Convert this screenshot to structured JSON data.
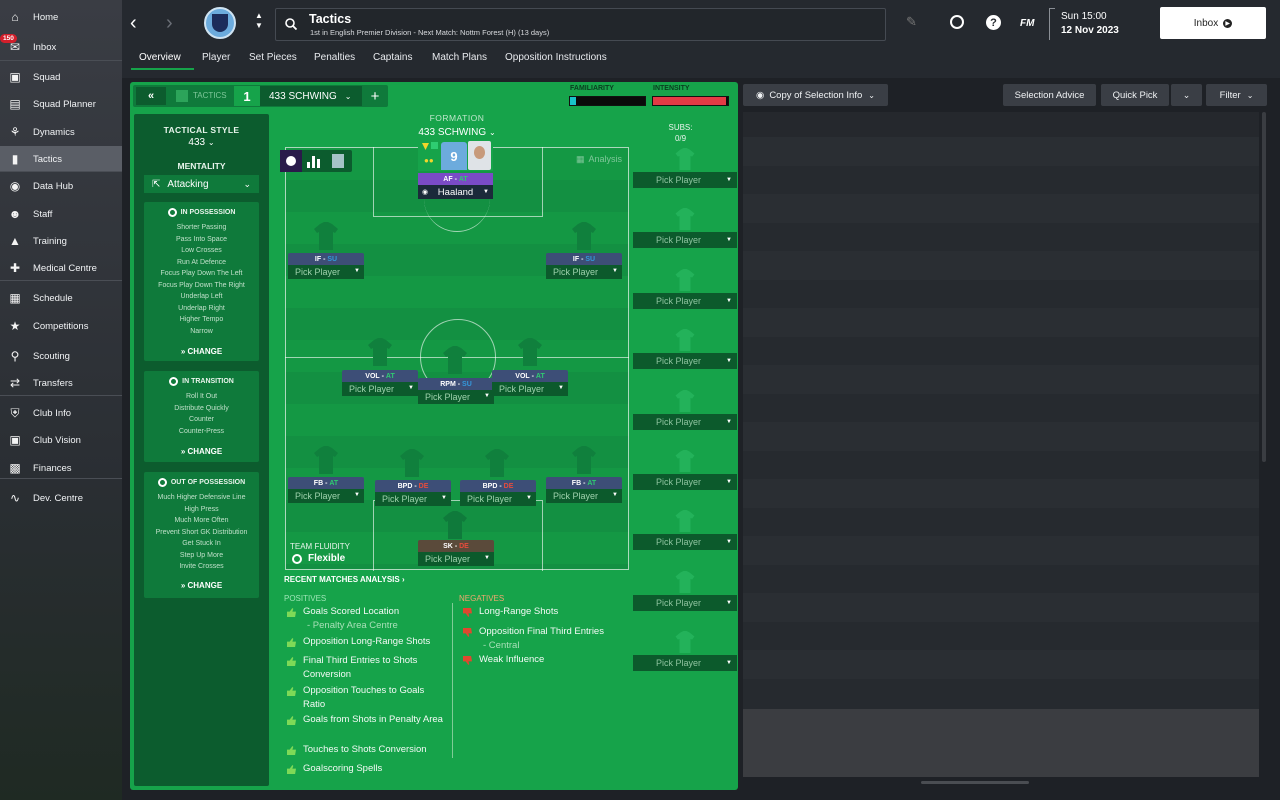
{
  "sidebar": {
    "inbox_badge": "150",
    "items": [
      {
        "label": "Home",
        "icon": "home-icon"
      },
      {
        "label": "Inbox",
        "icon": "inbox-icon"
      },
      {
        "label": "Squad",
        "icon": "squad-icon"
      },
      {
        "label": "Squad Planner",
        "icon": "planner-icon"
      },
      {
        "label": "Dynamics",
        "icon": "dynamics-icon"
      },
      {
        "label": "Tactics",
        "icon": "tactics-icon"
      },
      {
        "label": "Data Hub",
        "icon": "datahub-icon"
      },
      {
        "label": "Staff",
        "icon": "staff-icon"
      },
      {
        "label": "Training",
        "icon": "training-icon"
      },
      {
        "label": "Medical Centre",
        "icon": "medical-icon"
      },
      {
        "label": "Schedule",
        "icon": "schedule-icon"
      },
      {
        "label": "Competitions",
        "icon": "trophy-icon"
      },
      {
        "label": "Scouting",
        "icon": "scouting-icon"
      },
      {
        "label": "Transfers",
        "icon": "transfers-icon"
      },
      {
        "label": "Club Info",
        "icon": "club-info-icon"
      },
      {
        "label": "Club Vision",
        "icon": "club-vision-icon"
      },
      {
        "label": "Finances",
        "icon": "finances-icon"
      },
      {
        "label": "Dev. Centre",
        "icon": "dev-centre-icon"
      }
    ]
  },
  "header": {
    "title": "Tactics",
    "subtitle": "1st in English Premier Division - Next Match: Nottm Forest (H) (13 days)",
    "fm_label": "FM",
    "day_time": "Sun 15:00",
    "date": "12 Nov 2023",
    "inbox_button": "Inbox"
  },
  "tabs": [
    "Overview",
    "Player",
    "Set Pieces",
    "Penalties",
    "Captains",
    "Match Plans",
    "Opposition Instructions"
  ],
  "tactic_bar": {
    "tactics_label": "TACTICS",
    "slot_number": "1",
    "tactic_name": "433 SCHWING",
    "familiarity_label": "FAMILIARITY",
    "familiarity_value": 0.08,
    "intensity_label": "INTENSITY",
    "intensity_value": 0.97
  },
  "left_panel": {
    "tactical_style_label": "TACTICAL STYLE",
    "tactical_style_value": "433",
    "mentality_label": "MENTALITY",
    "mentality_value": "Attacking",
    "in_possession": {
      "title": "IN POSSESSION",
      "items": [
        "Shorter Passing",
        "Pass Into Space",
        "Low Crosses",
        "Run At Defence",
        "Focus Play Down The Left",
        "Focus Play Down The Right",
        "Underlap Left",
        "Underlap Right",
        "Higher Tempo",
        "Narrow"
      ],
      "change": "CHANGE"
    },
    "in_transition": {
      "title": "IN TRANSITION",
      "items": [
        "Roll It Out",
        "Distribute Quickly",
        "Counter",
        "Counter-Press"
      ],
      "change": "CHANGE"
    },
    "out_of_possession": {
      "title": "OUT OF POSSESSION",
      "items": [
        "Much Higher Defensive Line",
        "High Press",
        "Much More Often",
        "Prevent Short GK Distribution",
        "Get Stuck In",
        "Step Up More",
        "Invite Crosses"
      ],
      "change": "CHANGE"
    }
  },
  "formation": {
    "label": "FORMATION",
    "name": "433 SCHWING",
    "analysis_label": "Analysis",
    "team_fluidity_label": "TEAM FLUIDITY",
    "team_fluidity_value": "Flexible",
    "striker": {
      "role": "AF",
      "duty": "AT",
      "name": "Haaland",
      "number": "9"
    },
    "pick_label": "Pick Player",
    "positions": [
      {
        "role": "IF",
        "duty": "SU"
      },
      {
        "role": "IF",
        "duty": "SU"
      },
      {
        "role": "VOL",
        "duty": "AT"
      },
      {
        "role": "RPM",
        "duty": "SU"
      },
      {
        "role": "VOL",
        "duty": "AT"
      },
      {
        "role": "FB",
        "duty": "AT"
      },
      {
        "role": "BPD",
        "duty": "DE"
      },
      {
        "role": "BPD",
        "duty": "DE"
      },
      {
        "role": "FB",
        "duty": "AT"
      },
      {
        "role": "SK",
        "duty": "DE"
      }
    ]
  },
  "subs": {
    "label": "SUBS:",
    "count": "0/9",
    "pick_label": "Pick Player"
  },
  "analysis": {
    "title": "RECENT MATCHES ANALYSIS",
    "positives_label": "POSITIVES",
    "negatives_label": "NEGATIVES",
    "positives": [
      {
        "text": "Goals Scored Location",
        "detail": "- Penalty Area Centre"
      },
      {
        "text": "Opposition Long-Range Shots",
        "detail": ""
      },
      {
        "text": "Final Third Entries to Shots Conversion",
        "detail": ""
      },
      {
        "text": "Opposition Touches to Goals Ratio",
        "detail": ""
      },
      {
        "text": "Goals from Shots in Penalty Area",
        "detail": ""
      },
      {
        "text": "Touches to Shots Conversion",
        "detail": ""
      },
      {
        "text": "Goalscoring Spells",
        "detail": ""
      }
    ],
    "negatives": [
      {
        "text": "Long-Range Shots",
        "detail": ""
      },
      {
        "text": "Opposition Final Third Entries",
        "detail": "- Central"
      },
      {
        "text": "Weak Influence",
        "detail": ""
      }
    ]
  },
  "right_toolbar": {
    "copy_selection": "Copy of Selection Info",
    "selection_advice": "Selection Advice",
    "quick_pick": "Quick Pick",
    "filter": "Filter"
  }
}
